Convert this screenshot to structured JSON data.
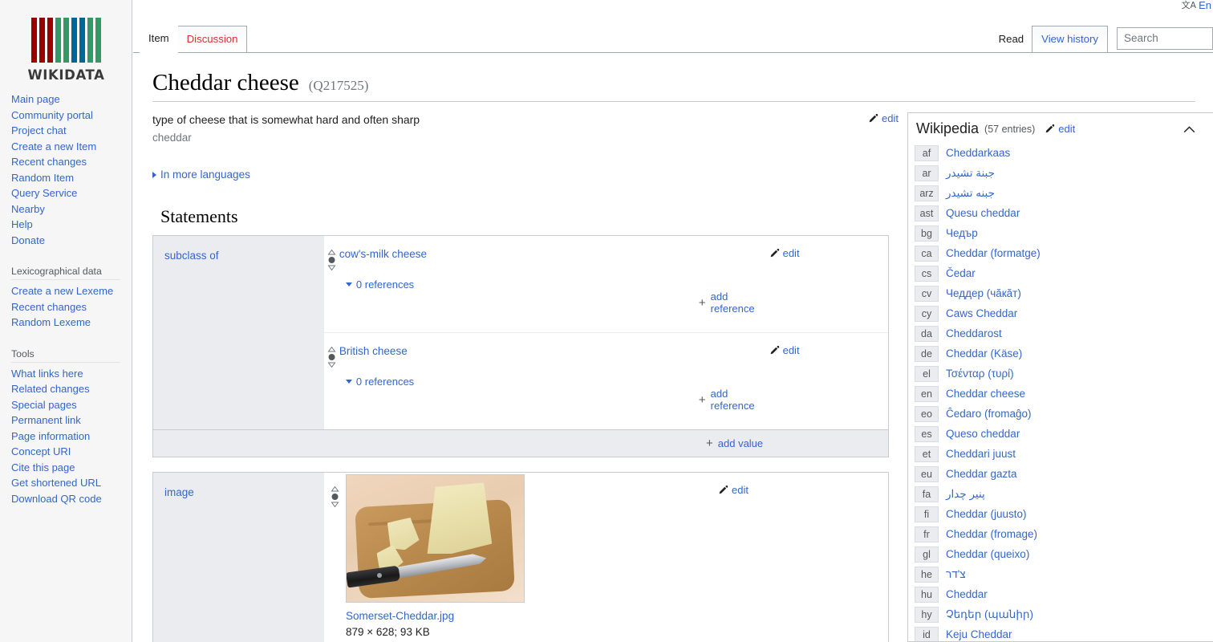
{
  "uls": {
    "icon": "language-icon",
    "lang": "En"
  },
  "tabs": {
    "left": [
      {
        "label": "Item",
        "state": "selected"
      },
      {
        "label": "Discussion",
        "state": "newpage"
      }
    ],
    "right": [
      {
        "label": "Read",
        "state": "plain"
      },
      {
        "label": "View history",
        "state": "link"
      }
    ],
    "search_placeholder": "Search"
  },
  "sidebar": {
    "logo_word": "WIKIDATA",
    "logo_bar_colors": [
      "#990000",
      "#990000",
      "#990000",
      "#339966",
      "#339966",
      "#006699",
      "#006699",
      "#339966",
      "#339966"
    ],
    "navigation": [
      {
        "label": "Main page"
      },
      {
        "label": "Community portal"
      },
      {
        "label": "Project chat"
      },
      {
        "label": "Create a new Item"
      },
      {
        "label": "Recent changes"
      },
      {
        "label": "Random Item"
      },
      {
        "label": "Query Service"
      },
      {
        "label": "Nearby"
      },
      {
        "label": "Help"
      },
      {
        "label": "Donate"
      }
    ],
    "lexicographical_heading": "Lexicographical data",
    "lexicographical": [
      {
        "label": "Create a new Lexeme"
      },
      {
        "label": "Recent changes"
      },
      {
        "label": "Random Lexeme"
      }
    ],
    "tools_heading": "Tools",
    "tools": [
      {
        "label": "What links here"
      },
      {
        "label": "Related changes"
      },
      {
        "label": "Special pages"
      },
      {
        "label": "Permanent link"
      },
      {
        "label": "Page information"
      },
      {
        "label": "Concept URI"
      },
      {
        "label": "Cite this page"
      },
      {
        "label": "Get shortened URL"
      },
      {
        "label": "Download QR code"
      }
    ]
  },
  "item": {
    "label": "Cheddar cheese",
    "id": "(Q217525)",
    "description": "type of cheese that is somewhat hard and often sharp",
    "aliases": "cheddar",
    "edit_label": "edit",
    "more_languages": "In more languages"
  },
  "statements": {
    "heading": "Statements",
    "groups": [
      {
        "property": "subclass of",
        "values": [
          {
            "value": "cow's-milk cheese",
            "edit_label": "edit",
            "references_label": "0 references",
            "add_reference_label": "add reference"
          },
          {
            "value": "British cheese",
            "edit_label": "edit",
            "references_label": "0 references",
            "add_reference_label": "add reference"
          }
        ],
        "add_value_label": "add value"
      },
      {
        "property": "image",
        "image_value": {
          "filename": "Somerset-Cheddar.jpg",
          "meta": "879 × 628; 93 KB",
          "edit_label": "edit"
        }
      }
    ]
  },
  "sitelinks": {
    "title": "Wikipedia",
    "count": "(57 entries)",
    "edit_label": "edit",
    "entries": [
      {
        "code": "af",
        "title": "Cheddarkaas",
        "rtl": false
      },
      {
        "code": "ar",
        "title": "جبنة تشيدر",
        "rtl": true
      },
      {
        "code": "arz",
        "title": "جبنه تشيدر",
        "rtl": true
      },
      {
        "code": "ast",
        "title": "Quesu cheddar",
        "rtl": false
      },
      {
        "code": "bg",
        "title": "Чедър",
        "rtl": false
      },
      {
        "code": "ca",
        "title": "Cheddar (formatge)",
        "rtl": false
      },
      {
        "code": "cs",
        "title": "Čedar",
        "rtl": false
      },
      {
        "code": "cv",
        "title": "Чеддер (чăкăт)",
        "rtl": false
      },
      {
        "code": "cy",
        "title": "Caws Cheddar",
        "rtl": false
      },
      {
        "code": "da",
        "title": "Cheddarost",
        "rtl": false
      },
      {
        "code": "de",
        "title": "Cheddar (Käse)",
        "rtl": false
      },
      {
        "code": "el",
        "title": "Τσένταρ (τυρί)",
        "rtl": false
      },
      {
        "code": "en",
        "title": "Cheddar cheese",
        "rtl": false
      },
      {
        "code": "eo",
        "title": "Ĉedaro (fromaĝo)",
        "rtl": false
      },
      {
        "code": "es",
        "title": "Queso cheddar",
        "rtl": false
      },
      {
        "code": "et",
        "title": "Cheddari juust",
        "rtl": false
      },
      {
        "code": "eu",
        "title": "Cheddar gazta",
        "rtl": false
      },
      {
        "code": "fa",
        "title": "پنیر چدار",
        "rtl": true
      },
      {
        "code": "fi",
        "title": "Cheddar (juusto)",
        "rtl": false
      },
      {
        "code": "fr",
        "title": "Cheddar (fromage)",
        "rtl": false
      },
      {
        "code": "gl",
        "title": "Cheddar (queixo)",
        "rtl": false
      },
      {
        "code": "he",
        "title": "צ'דר",
        "rtl": true
      },
      {
        "code": "hu",
        "title": "Cheddar",
        "rtl": false
      },
      {
        "code": "hy",
        "title": "Չեդեր (պանիր)",
        "rtl": false
      },
      {
        "code": "id",
        "title": "Keju Cheddar",
        "rtl": false
      }
    ]
  },
  "colors": {
    "link": "#3366cc",
    "newpage_link": "#d73333",
    "sidebar_bg": "#f6f6f6",
    "prop_bg": "#eaecf0",
    "border": "#c8ccd1"
  }
}
